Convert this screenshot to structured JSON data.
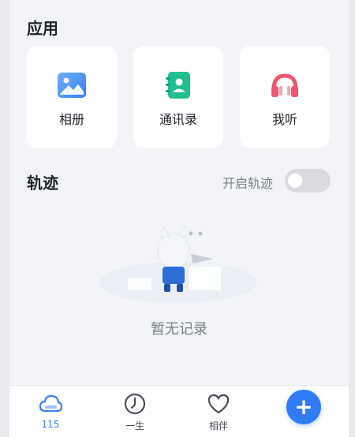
{
  "apps": {
    "title": "应用",
    "items": [
      {
        "label": "相册",
        "icon": "album-icon"
      },
      {
        "label": "通讯录",
        "icon": "contacts-icon"
      },
      {
        "label": "我听",
        "icon": "headphones-icon"
      }
    ]
  },
  "track": {
    "title": "轨迹",
    "toggle_label": "开启轨迹",
    "toggle_on": false,
    "empty_text": "暂无记录"
  },
  "tabbar": {
    "tabs": [
      {
        "label": "115",
        "icon": "cloud-icon",
        "active": true
      },
      {
        "label": "一生",
        "icon": "clock-icon",
        "active": false
      },
      {
        "label": "相伴",
        "icon": "heart-icon",
        "active": false
      }
    ],
    "fab_label": "+"
  },
  "colors": {
    "accent": "#2f7cf6",
    "background": "#f3f4f7",
    "card": "#ffffff",
    "contacts_green": "#1fbf8f",
    "headphones_pink": "#f0566e"
  }
}
